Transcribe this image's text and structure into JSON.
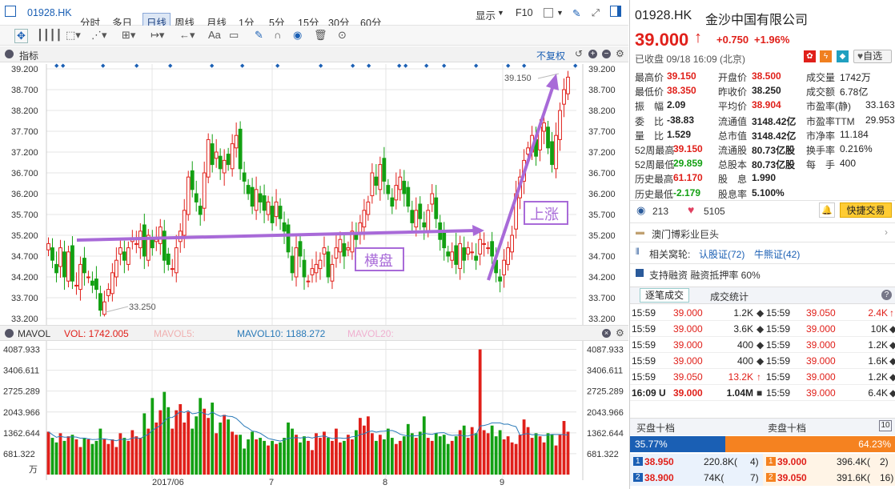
{
  "toolbar": {
    "code": "01928.HK",
    "periods": [
      "分时",
      "多日",
      "日线",
      "周线",
      "月线",
      "1分",
      "5分",
      "15分",
      "30分",
      "60分"
    ],
    "active_period": "日线",
    "display_label": "显示",
    "f10_label": "F10"
  },
  "indicator_bar": {
    "label": "指标",
    "adjust_label": "不复权"
  },
  "chart_data": {
    "type": "candlestick",
    "y_ticks": [
      "39.200",
      "38.700",
      "38.200",
      "37.700",
      "37.200",
      "36.700",
      "36.200",
      "35.700",
      "35.200",
      "34.700",
      "34.200",
      "33.700",
      "33.200"
    ],
    "ylim": [
      33.2,
      39.2
    ],
    "x_ticks": [
      "2017/06",
      "7",
      "8",
      "9"
    ],
    "annotations": {
      "high_label": "39.150",
      "low_label": "33.250",
      "sideways_label": "横盘",
      "rise_label": "上涨"
    },
    "volume": {
      "y_ticks": [
        "4087.933",
        "3406.611",
        "2725.289",
        "2043.966",
        "1362.644",
        "681.322"
      ],
      "unit": "万",
      "ylim": [
        0,
        4087.933
      ]
    },
    "volume_header": {
      "name": "MAVOL",
      "vol": "VOL: 1742.005",
      "mavol5": "MAVOL5:",
      "mavol10": "MAVOL10: 1188.272",
      "mavol20": "MAVOL20:"
    }
  },
  "quote": {
    "code": "01928.HK",
    "name": "金沙中国有限公司",
    "price": "39.000",
    "change": "+0.750",
    "change_pct": "+1.96%",
    "status": "已收盘 09/18 16:09 (北京)",
    "watch_label": "自选",
    "stats": [
      [
        {
          "k": "最高价",
          "v": "39.150",
          "c": "red"
        },
        {
          "k": "开盘价",
          "v": "38.500",
          "c": "red"
        },
        {
          "k": "成交量",
          "v": "1742万",
          "c": ""
        }
      ],
      [
        {
          "k": "最低价",
          "v": "38.350",
          "c": "red"
        },
        {
          "k": "昨收价",
          "v": "38.250",
          "c": ""
        },
        {
          "k": "成交额",
          "v": "6.78亿",
          "c": ""
        }
      ],
      [
        {
          "k": "振　幅",
          "v": "2.09",
          "c": ""
        },
        {
          "k": "平均价",
          "v": "38.904",
          "c": "red"
        },
        {
          "k": "市盈率(静)",
          "v": "33.163",
          "c": ""
        }
      ],
      [
        {
          "k": "委　比",
          "v": "-38.83",
          "c": ""
        },
        {
          "k": "流通值",
          "v": "3148.42亿",
          "c": ""
        },
        {
          "k": "市盈率TTM",
          "v": "29.953",
          "c": ""
        }
      ],
      [
        {
          "k": "量　比",
          "v": "1.529",
          "c": ""
        },
        {
          "k": "总市值",
          "v": "3148.42亿",
          "c": ""
        },
        {
          "k": "市净率",
          "v": "11.184",
          "c": ""
        }
      ],
      [
        {
          "k": "52周最高",
          "v": "39.150",
          "c": "red"
        },
        {
          "k": "流通股",
          "v": "80.73亿股",
          "c": ""
        },
        {
          "k": "换手率",
          "v": "0.216%",
          "c": ""
        }
      ],
      [
        {
          "k": "52周最低",
          "v": "29.859",
          "c": "green"
        },
        {
          "k": "总股本",
          "v": "80.73亿股",
          "c": ""
        },
        {
          "k": "每　手",
          "v": "400",
          "c": ""
        }
      ],
      [
        {
          "k": "历史最高",
          "v": "61.170",
          "c": "red"
        },
        {
          "k": "股　息",
          "v": "1.990",
          "c": ""
        }
      ],
      [
        {
          "k": "历史最低",
          "v": "-2.179",
          "c": "green"
        },
        {
          "k": "股息率",
          "v": "5.100%",
          "c": ""
        }
      ]
    ],
    "views": "213",
    "likes": "5105",
    "trade_btn": "快捷交易",
    "sector": "澳门博彩业巨头",
    "warrant_label": "相关窝轮:",
    "warrant_call": "认股证(72)",
    "warrant_bull": "牛熊证(42)",
    "margin": "支持融资 融资抵押率 60%",
    "tabs": [
      "逐笔成交",
      "成交统计"
    ],
    "ticks_left": [
      [
        "15:59",
        "39.000",
        "1.2K"
      ],
      [
        "15:59",
        "39.000",
        "3.6K"
      ],
      [
        "15:59",
        "39.000",
        "400"
      ],
      [
        "15:59",
        "39.000",
        "400"
      ],
      [
        "15:59",
        "39.050",
        "13.2K"
      ],
      [
        "16:09 U",
        "39.000",
        "1.04M"
      ]
    ],
    "ticks_right": [
      [
        "15:59",
        "39.050",
        "2.4K"
      ],
      [
        "15:59",
        "39.000",
        "10K"
      ],
      [
        "15:59",
        "39.000",
        "1.2K"
      ],
      [
        "15:59",
        "39.000",
        "1.6K"
      ],
      [
        "15:59",
        "39.000",
        "1.2K"
      ],
      [
        "15:59",
        "39.000",
        "6.4K"
      ]
    ],
    "book_sell_label": "买盘十档",
    "book_buy_label": "卖盘十档",
    "book_count": "10",
    "bid_pct": "35.77%",
    "ask_pct": "64.23%",
    "bids": [
      [
        "1",
        "38.950",
        "220.8K(",
        "4)"
      ],
      [
        "2",
        "38.900",
        "74K(",
        "7)"
      ]
    ],
    "asks": [
      [
        "1",
        "39.000",
        "396.4K(",
        "2)"
      ],
      [
        "2",
        "39.050",
        "391.6K(",
        "16)"
      ]
    ]
  }
}
